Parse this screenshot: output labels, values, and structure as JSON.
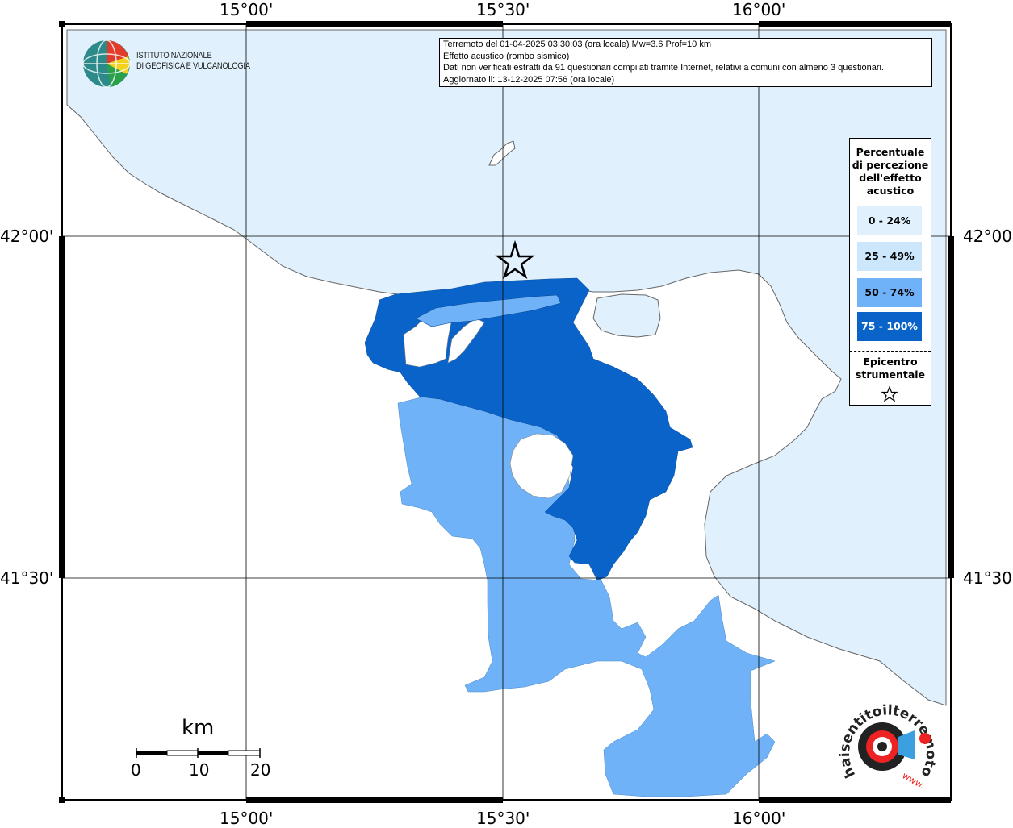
{
  "map": {
    "top_labels": [
      "15°00'",
      "15°30'",
      "16°00'"
    ],
    "bottom_labels": [
      "15°00'",
      "15°30'",
      "16°00'"
    ],
    "left_labels": [
      "42°00'",
      "41°30'"
    ],
    "right_labels": [
      "42°00'",
      "41°30'"
    ],
    "colors": {
      "sea": "#e0f1fd",
      "land": "#ffffff",
      "class_0_24": "#e0f1fd",
      "class_25_49": "#cce6fb",
      "class_50_74": "#6fb2f7",
      "class_75_100": "#0a63c9",
      "border": "#8c8c8c"
    }
  },
  "info": {
    "line1": "Terremoto del 01-04-2025 03:30:03 (ora locale) Mw=3.6 Prof=10 km",
    "line2": "Effetto acustico (rombo sismico)",
    "line3": "Dati non verificati estratti da 91 questionari compilati tramite Internet, relativi a comuni con almeno 3 questionari.",
    "line4": "Aggiornato il: 13-12-2025 07:56 (ora locale)"
  },
  "logo": {
    "line1": "ISTITUTO NAZIONALE",
    "line2": "DI GEOFISICA E VULCANOLOGIA"
  },
  "legend": {
    "title_lines": [
      "Percentuale",
      "di percezione",
      "dell'effetto",
      "acustico"
    ],
    "items": [
      {
        "label": "0 - 24%",
        "color": "#e0f1fd"
      },
      {
        "label": "25 - 49%",
        "color": "#cce6fb"
      },
      {
        "label": "50 - 74%",
        "color": "#6fb2f7"
      },
      {
        "label": "75 - 100%",
        "color": "#0a63c9"
      }
    ],
    "epicenter_lines": [
      "Epicentro",
      "strumentale"
    ]
  },
  "scale": {
    "unit": "km",
    "ticks": [
      "0",
      "10",
      "20"
    ]
  },
  "watermark": {
    "text": "haisentitoilterremoto.it",
    "prefix": "www."
  }
}
